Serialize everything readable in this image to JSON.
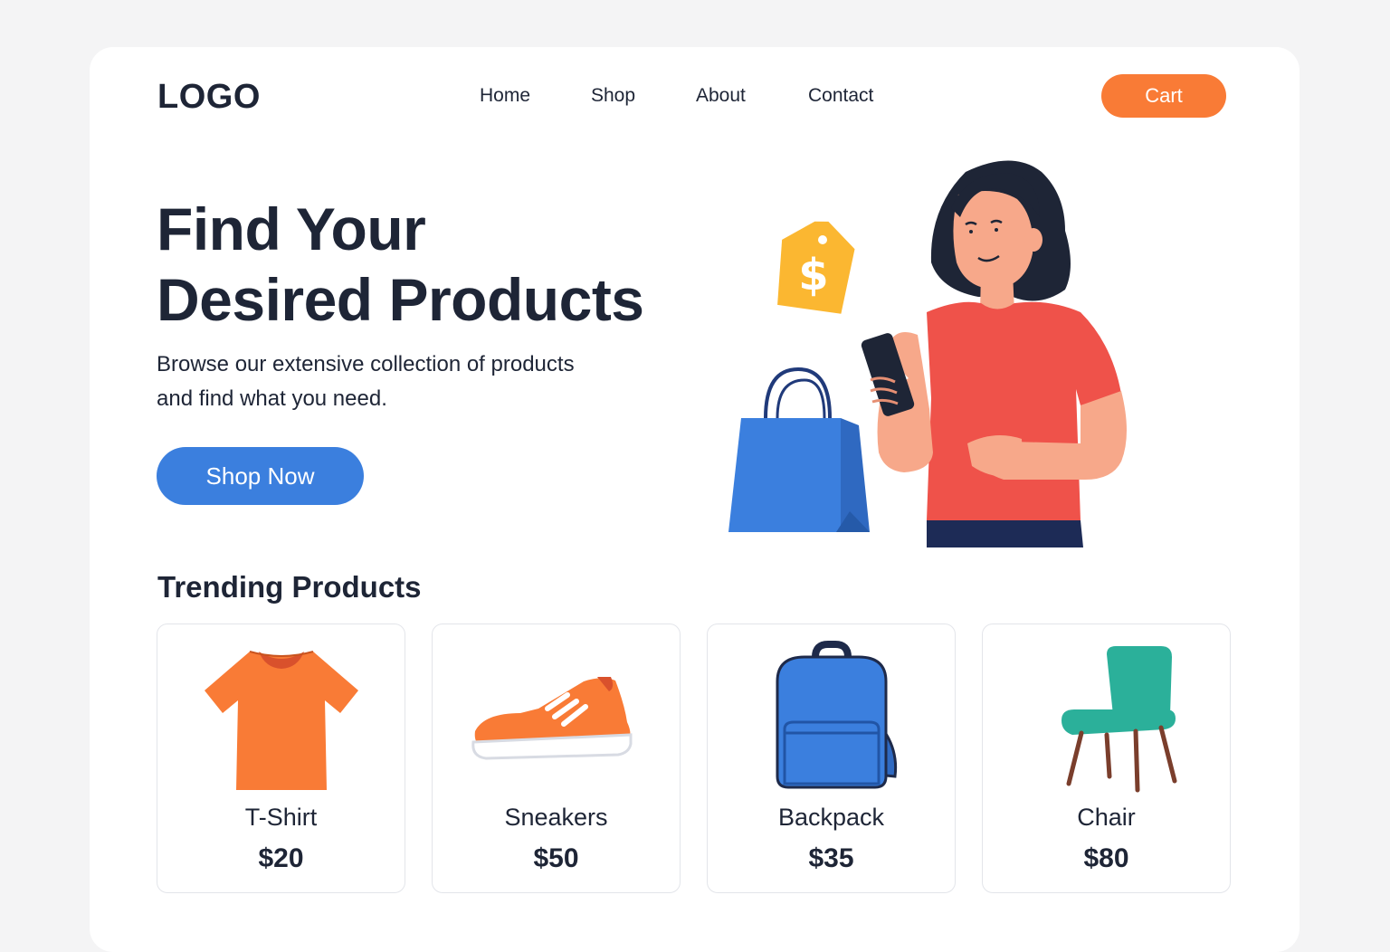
{
  "header": {
    "logo": "LOGO",
    "nav": [
      {
        "label": "Home"
      },
      {
        "label": "Shop"
      },
      {
        "label": "About"
      },
      {
        "label": "Contact"
      }
    ],
    "cart_label": "Cart"
  },
  "hero": {
    "title_line1": "Find Your",
    "title_line2": "Desired Products",
    "subtitle_line1": "Browse our extensive collection of products",
    "subtitle_line2": "and find what you need.",
    "cta_label": "Shop Now",
    "price_tag_symbol": "$"
  },
  "trending": {
    "title": "Trending Products",
    "products": [
      {
        "name": "T-Shirt",
        "price": "$20",
        "icon": "t-shirt-icon"
      },
      {
        "name": "Sneakers",
        "price": "$50",
        "icon": "sneaker-icon"
      },
      {
        "name": "Backpack",
        "price": "$35",
        "icon": "backpack-icon"
      },
      {
        "name": "Chair",
        "price": "$80",
        "icon": "chair-icon"
      }
    ]
  },
  "colors": {
    "accent_orange": "#f97b36",
    "accent_blue": "#3b7fde",
    "text_dark": "#1e2536",
    "teal": "#2bb09a",
    "tag_yellow": "#fbb731"
  }
}
